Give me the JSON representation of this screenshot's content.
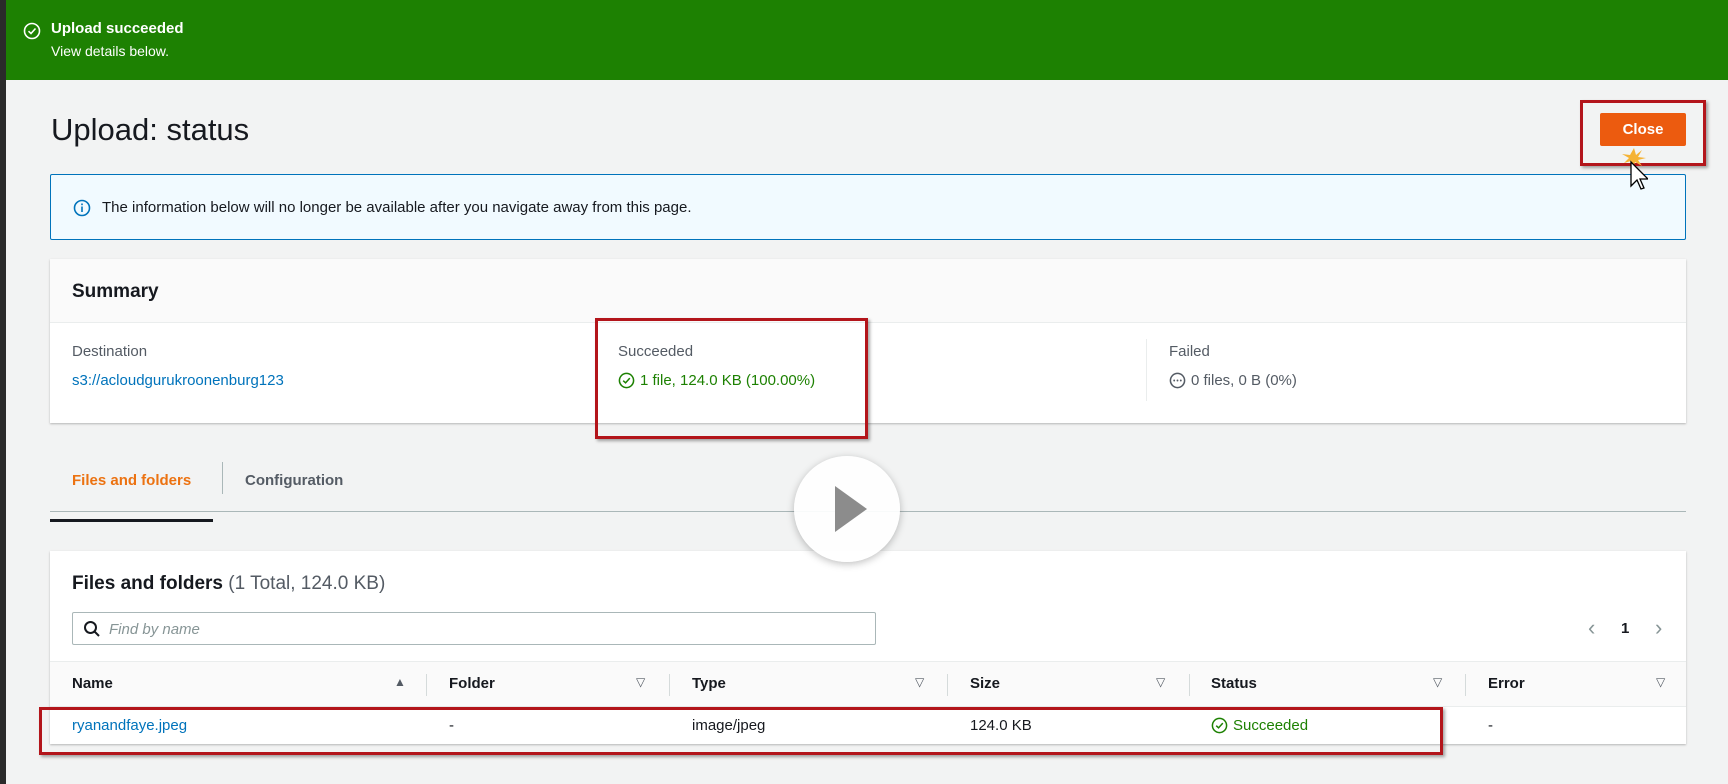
{
  "flash": {
    "title": "Upload succeeded",
    "subtitle": "View details below.",
    "icon": "check-circle-icon",
    "color": "#1d8102"
  },
  "header": {
    "title": "Upload: status",
    "close_label": "Close",
    "close_color": "#ec5b0f"
  },
  "info": {
    "icon": "info-icon",
    "text": "The information below will no longer be available after you navigate away from this page."
  },
  "summary": {
    "title": "Summary",
    "destination_label": "Destination",
    "destination_value": "s3://acloudgurukroonenburg123",
    "succeeded_label": "Succeeded",
    "succeeded_value": "1 file, 124.0 KB (100.00%)",
    "failed_label": "Failed",
    "failed_value": "0 files, 0 B (0%)"
  },
  "tabs": [
    {
      "label": "Files and folders",
      "active": true
    },
    {
      "label": "Configuration",
      "active": false
    }
  ],
  "files": {
    "title": "Files and folders",
    "count": "(1 Total, 124.0 KB)",
    "search_placeholder": "Find by name",
    "page": "1",
    "columns": [
      "Name",
      "Folder",
      "Type",
      "Size",
      "Status",
      "Error"
    ],
    "rows": [
      {
        "name": "ryanandfaye.jpeg",
        "folder": "-",
        "type": "image/jpeg",
        "size": "124.0 KB",
        "status": "Succeeded",
        "error": "-"
      }
    ]
  }
}
